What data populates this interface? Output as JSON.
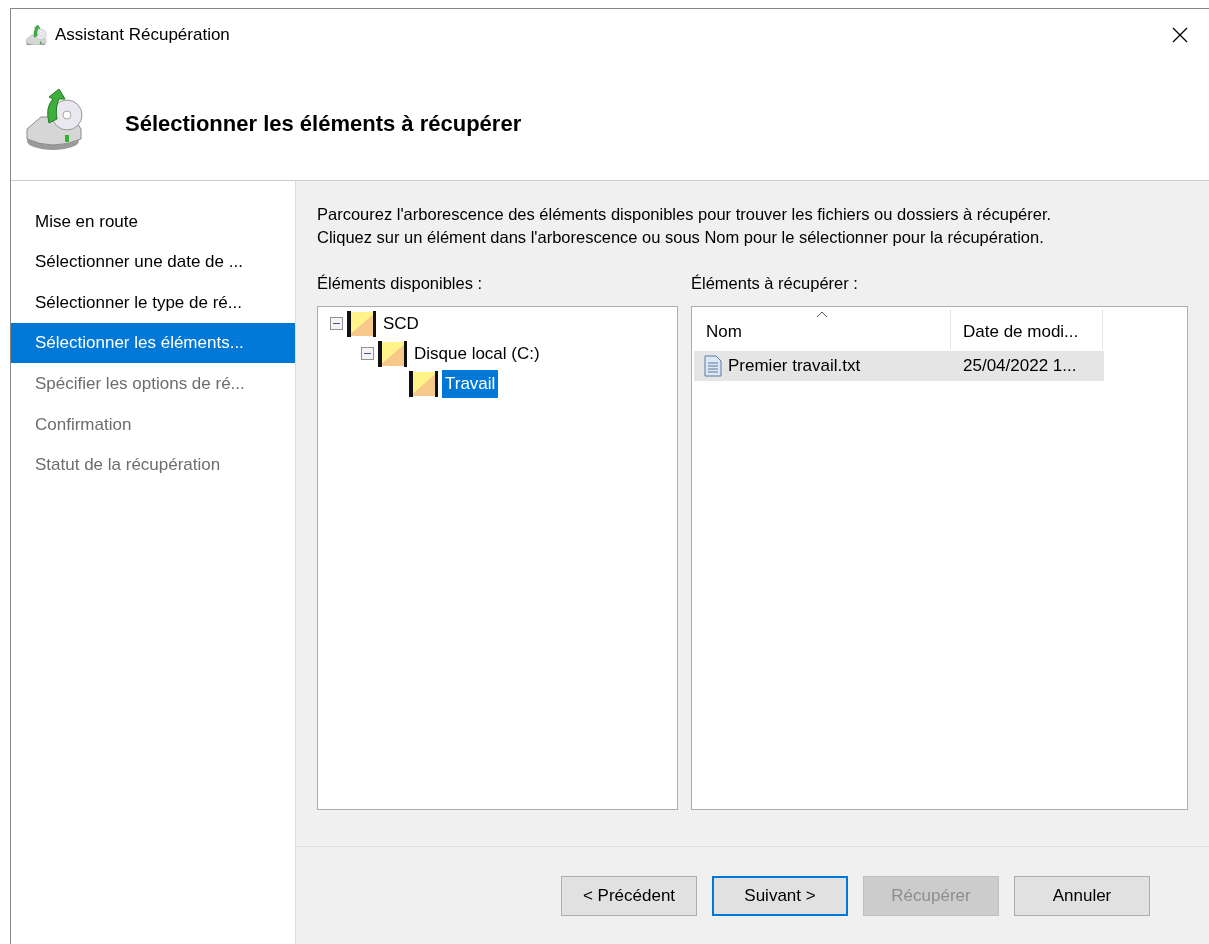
{
  "window": {
    "title": "Assistant Récupération"
  },
  "header": {
    "title": "Sélectionner les éléments à récupérer"
  },
  "steps": [
    {
      "label": "Mise en route",
      "selected": false,
      "disabled": false
    },
    {
      "label": "Sélectionner une date de ...",
      "selected": false,
      "disabled": false
    },
    {
      "label": "Sélectionner le type de ré...",
      "selected": false,
      "disabled": false
    },
    {
      "label": "Sélectionner les éléments...",
      "selected": true,
      "disabled": false
    },
    {
      "label": "Spécifier les options de ré...",
      "selected": false,
      "disabled": true
    },
    {
      "label": "Confirmation",
      "selected": false,
      "disabled": true
    },
    {
      "label": "Statut de la récupération",
      "selected": false,
      "disabled": true
    }
  ],
  "instructions": "Parcourez l'arborescence des éléments disponibles pour trouver les fichiers ou dossiers à récupérer.\nCliquez sur un élément dans l'arborescence ou sous Nom pour le sélectionner pour la récupération.",
  "tree": {
    "label": "Éléments disponibles :",
    "items": [
      {
        "label": "SCD",
        "selected": false,
        "expanded": true,
        "children": [
          {
            "label": "Disque local (C:)",
            "selected": false,
            "expanded": true,
            "children": [
              {
                "label": "Travail",
                "selected": true
              }
            ]
          }
        ]
      }
    ]
  },
  "list": {
    "label": "Éléments à récupérer :",
    "columns": [
      {
        "label": "Nom",
        "sorted": true
      },
      {
        "label": "Date de modi...",
        "sorted": false
      }
    ],
    "rows": [
      {
        "cells": [
          "Premier travail.txt",
          "25/04/2022 1..."
        ],
        "selected": true
      }
    ]
  },
  "buttons": [
    {
      "label": "< Précédent",
      "default": false,
      "disabled": false
    },
    {
      "label": "Suivant >",
      "default": true,
      "disabled": false
    },
    {
      "label": "Récupérer",
      "default": false,
      "disabled": true
    },
    {
      "label": "Annuler",
      "default": false,
      "disabled": false
    }
  ]
}
